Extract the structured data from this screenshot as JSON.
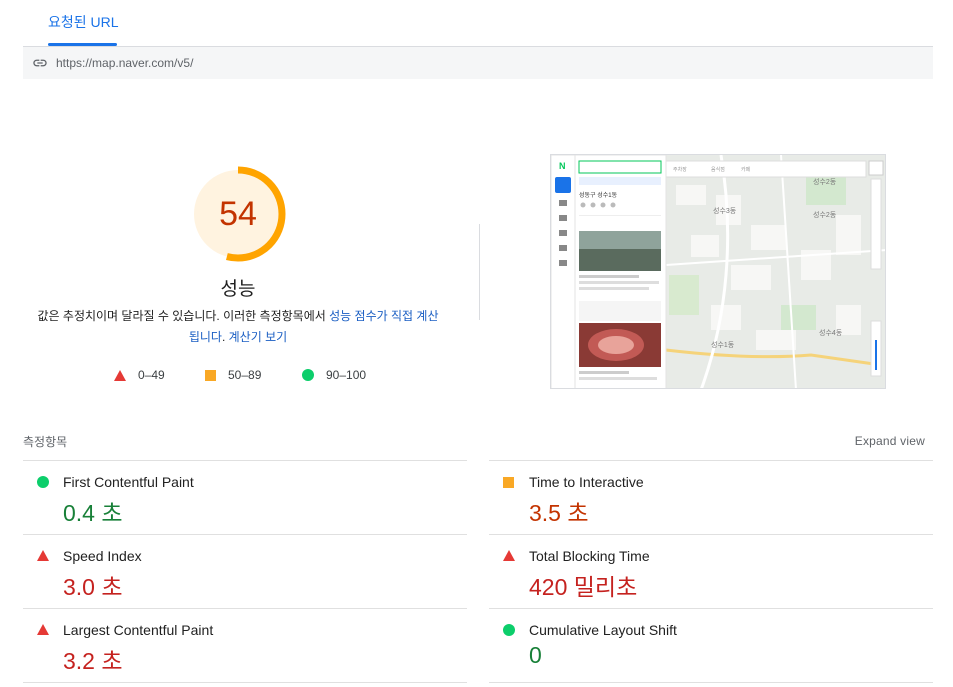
{
  "tab": {
    "label": "요청된 URL"
  },
  "url": "https://map.naver.com/v5/",
  "score": {
    "value": "54",
    "fraction": 0.54,
    "label": "성능",
    "color": "#ffa400",
    "track_color": "#fff3e0"
  },
  "description": {
    "prefix": "값은 추정치이며 달라질 수 있습니다. 이러한 측정항목에서 ",
    "link1": "성능 점수가 직접 계산됩니다",
    "middle": ". ",
    "link2": "계산기 보기"
  },
  "legend": [
    {
      "shape": "triangle",
      "label": "0–49",
      "color": "#e53935"
    },
    {
      "shape": "square",
      "label": "50–89",
      "color": "#f9a825"
    },
    {
      "shape": "circle",
      "label": "90–100",
      "color": "#0cce6b"
    }
  ],
  "metrics_section": {
    "title": "측정항목",
    "expand_label": "Expand view"
  },
  "metrics": [
    {
      "name": "First Contentful Paint",
      "value": "0.4 초",
      "status": "good"
    },
    {
      "name": "Time to Interactive",
      "value": "3.5 초",
      "status": "average"
    },
    {
      "name": "Speed Index",
      "value": "3.0 초",
      "status": "poor"
    },
    {
      "name": "Total Blocking Time",
      "value": "420 밀리초",
      "status": "poor"
    },
    {
      "name": "Largest Contentful Paint",
      "value": "3.2 초",
      "status": "poor"
    },
    {
      "name": "Cumulative Layout Shift",
      "value": "0",
      "status": "good"
    }
  ],
  "screenshot_thumbnail": {
    "search_placeholder": "",
    "place_title": "성동구 성수1동",
    "map_labels": [
      "성수2동",
      "성수1동",
      "성수3동",
      "성수4동"
    ]
  }
}
